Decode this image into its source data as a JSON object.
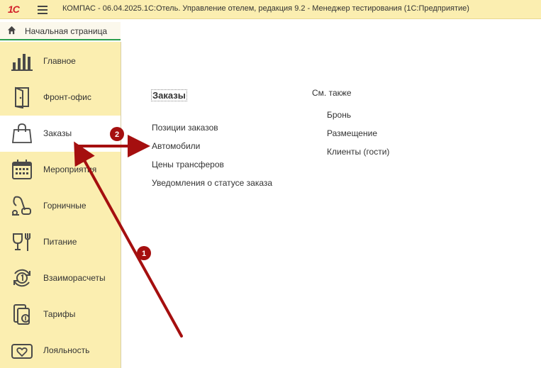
{
  "titlebar": {
    "logo": "1С",
    "title": "КОМПАС - 06.04.2025.1С:Отель. Управление отелем, редакция 9.2  - Менеджер тестирования (1С:Предприятие)"
  },
  "home_tab": {
    "label": "Начальная страница"
  },
  "sidebar": {
    "items": [
      {
        "label": "Главное",
        "icon": "bar-chart-icon"
      },
      {
        "label": "Фронт-офис",
        "icon": "door-icon"
      },
      {
        "label": "Заказы",
        "icon": "shopping-bag-icon",
        "active": true
      },
      {
        "label": "Мероприятия",
        "icon": "calendar-icon"
      },
      {
        "label": "Горничные",
        "icon": "vacuum-icon"
      },
      {
        "label": "Питание",
        "icon": "cup-fork-icon"
      },
      {
        "label": "Взаиморасчеты",
        "icon": "settlement-icon"
      },
      {
        "label": "Тарифы",
        "icon": "tariff-icon"
      },
      {
        "label": "Лояльность",
        "icon": "heart-card-icon"
      }
    ]
  },
  "main": {
    "section_title": "Заказы",
    "links": [
      "Позиции заказов",
      "Автомобили",
      "Цены трансферов",
      "Уведомления о статусе заказа"
    ],
    "see_also_title": "См. также",
    "see_also_links": [
      "Бронь",
      "Размещение",
      "Клиенты (гости)"
    ]
  },
  "annotations": {
    "markers": [
      "1",
      "2"
    ],
    "color": "#a50f0f"
  },
  "colors": {
    "sidebar_bg": "#fbeeb0",
    "accent_green": "#2a9d4d",
    "logo_red": "#d2202a"
  }
}
